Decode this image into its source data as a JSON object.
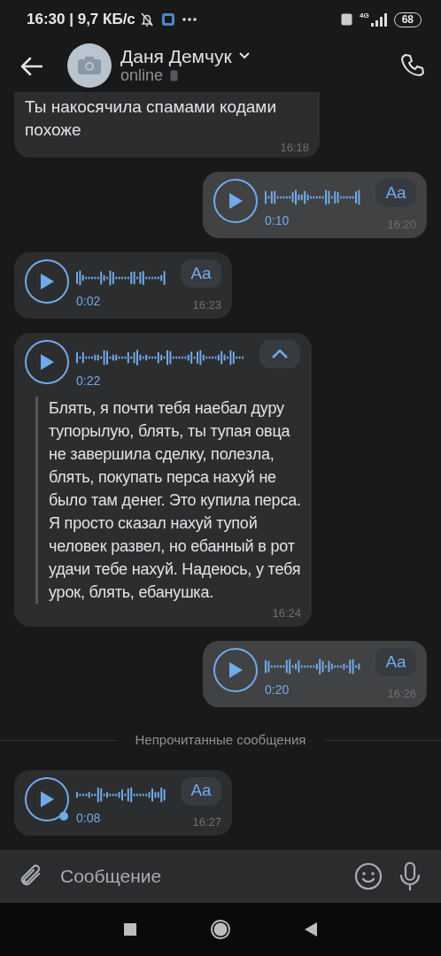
{
  "status_bar": {
    "time": "16:30 | 9,7 КБ/с",
    "network": "4G",
    "battery": "68"
  },
  "header": {
    "name": "Даня Демчук",
    "status": "online"
  },
  "messages": [
    {
      "kind": "text",
      "outgoing": false,
      "text": "Ты накосячила спамами кодами похоже",
      "time": "16:18"
    },
    {
      "kind": "voice",
      "outgoing": true,
      "duration": "0:10",
      "time": "16:20",
      "transcribe_label": "Aa",
      "expanded": false,
      "unlistened": false
    },
    {
      "kind": "voice",
      "outgoing": false,
      "duration": "0:02",
      "time": "16:23",
      "transcribe_label": "Aa",
      "expanded": false,
      "unlistened": false
    },
    {
      "kind": "voice",
      "outgoing": false,
      "duration": "0:22",
      "time": "16:24",
      "expanded": true,
      "unlistened": false,
      "transcript": "Блять, я почти тебя наебал дуру тупорылую, блять, ты тупая овца не завершила сделку, полезла, блять, покупать перса нахуй не было там денег. Это купила перса. Я просто сказал нахуй тупой человек развел, но ебанный в рот удачи тебе нахуй. Надеюсь, у тебя урок, блять, ебанушка."
    },
    {
      "kind": "voice",
      "outgoing": true,
      "duration": "0:20",
      "time": "16:26",
      "transcribe_label": "Aa",
      "expanded": false,
      "unlistened": false
    },
    {
      "kind": "divider",
      "text": "Непрочитанные сообщения"
    },
    {
      "kind": "voice",
      "outgoing": false,
      "duration": "0:08",
      "time": "16:27",
      "transcribe_label": "Aa",
      "expanded": false,
      "unlistened": true
    }
  ],
  "composer": {
    "placeholder": "Сообщение"
  }
}
